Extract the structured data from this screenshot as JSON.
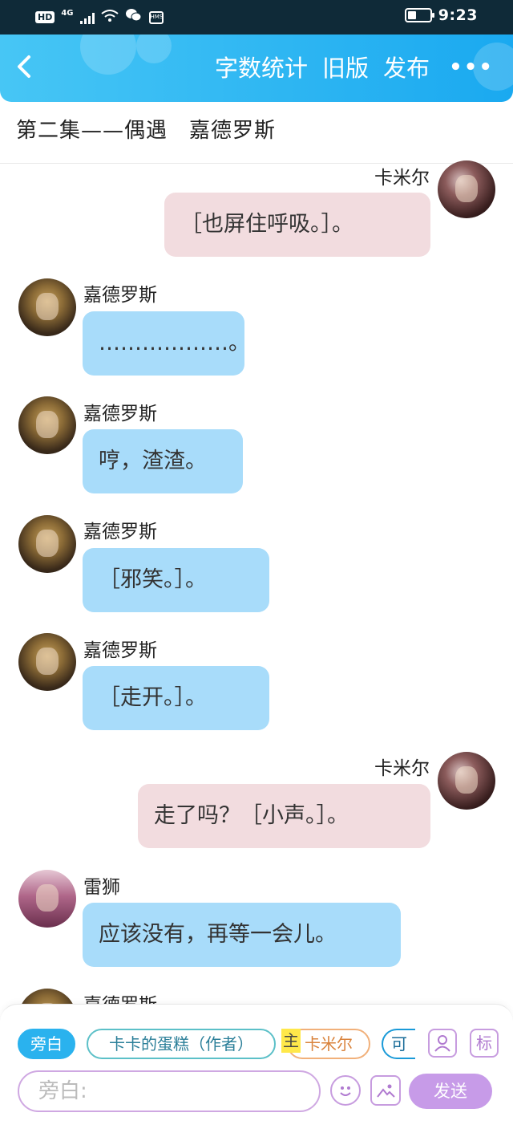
{
  "status_bar": {
    "hd": "HD",
    "network": "4G",
    "hms": "HMS",
    "time": "9:23",
    "battery_level": 0.4
  },
  "header": {
    "back_icon": "chevron-left-icon",
    "actions": {
      "word_count": "字数统计",
      "old_version": "旧版",
      "publish": "发布"
    },
    "more": "•••"
  },
  "chapter_title": "第二集——偶遇　嘉德罗斯",
  "messages": [
    {
      "side": "right",
      "name": "卡米尔",
      "text": "［也屏住呼吸。］。",
      "avatar": "camille-avatar"
    },
    {
      "side": "left",
      "name": "嘉德罗斯",
      "text": "………………。",
      "avatar": "garcia-avatar"
    },
    {
      "side": "left",
      "name": "嘉德罗斯",
      "text": "哼，渣渣。",
      "avatar": "garcia-avatar"
    },
    {
      "side": "left",
      "name": "嘉德罗斯",
      "text": "［邪笑。］。",
      "avatar": "garcia-avatar"
    },
    {
      "side": "left",
      "name": "嘉德罗斯",
      "text": "［走开。］。",
      "avatar": "garcia-avatar"
    },
    {
      "side": "right",
      "name": "卡米尔",
      "text": "走了吗？［小声。］。",
      "avatar": "camille-avatar"
    },
    {
      "side": "left",
      "name": "雷狮",
      "text": "应该没有，再等一会儿。",
      "avatar": "leishi-avatar"
    },
    {
      "side": "left",
      "name": "嘉德罗斯",
      "text": "",
      "avatar": "garcia-avatar"
    }
  ],
  "role_bar": {
    "aside": "旁白",
    "author": "卡卡的蛋糕（作者）",
    "main_tag": "主",
    "camille": "卡米尔",
    "more_chip": "可",
    "role_icon": "person-icon",
    "mark_label": "标"
  },
  "composer": {
    "placeholder": "旁白:",
    "emoji_icon": "smiley-icon",
    "image_icon": "image-icon",
    "send": "发送"
  },
  "colors": {
    "nav_gradient_start": "#47c6f5",
    "nav_gradient_end": "#1aa9f0",
    "left_bubble": "#a8dcfa",
    "right_bubble": "#f2dcdf",
    "send_button": "#c79be8"
  }
}
